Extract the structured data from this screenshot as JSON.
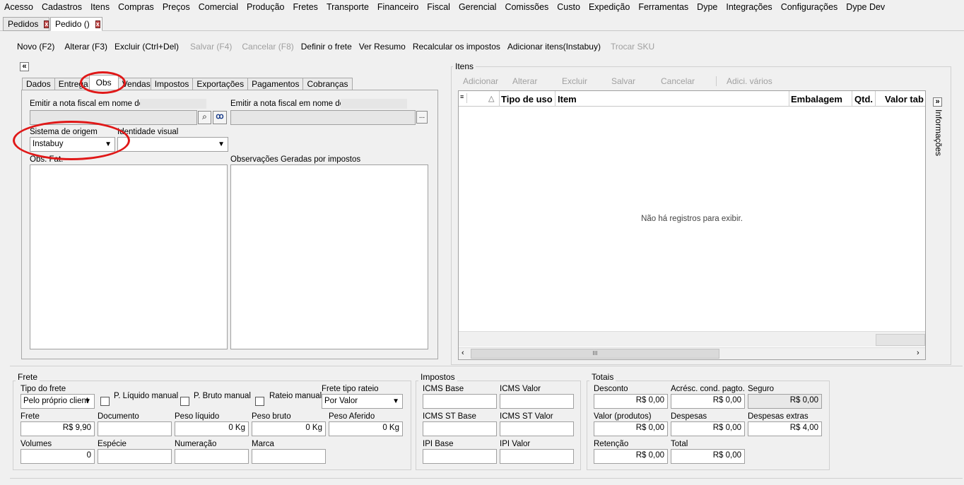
{
  "menu": [
    "Acesso",
    "Cadastros",
    "Itens",
    "Compras",
    "Preços",
    "Comercial",
    "Produção",
    "Fretes",
    "Transporte",
    "Financeiro",
    "Fiscal",
    "Gerencial",
    "Comissões",
    "Custo",
    "Expedição",
    "Ferramentas",
    "Dype",
    "Integrações",
    "Configurações",
    "Dype Dev"
  ],
  "doc_tabs": [
    {
      "label": "Pedidos",
      "close": "x"
    },
    {
      "label": "Pedido ()",
      "close": "x"
    }
  ],
  "toolbar": {
    "novo": "Novo (F2)",
    "alterar": "Alterar (F3)",
    "excluir": "Excluir (Ctrl+Del)",
    "salvar": "Salvar (F4)",
    "cancelar": "Cancelar (F8)",
    "definir_frete": "Definir o frete",
    "ver_resumo": "Ver Resumo",
    "recalcular": "Recalcular os impostos",
    "adicionar_itens": "Adicionar itens(Instabuy)",
    "trocar_sku": "Trocar SKU"
  },
  "collapse_icon": "«",
  "left_tabs": [
    "Dados",
    "Entrega",
    "Obs",
    "Vendas",
    "Impostos",
    "Exportações",
    "Pagamentos",
    "Cobranças"
  ],
  "obs": {
    "emitir1_label": "Emitir a nota fiscal em nome de:",
    "emitir2_label": "Emitir a nota fiscal em nome de:",
    "sistema_origem_label": "Sistema de origem",
    "sistema_origem_value": "Instabuy",
    "identidade_visual_label": "Identidade visual",
    "identidade_visual_value": "",
    "obs_label": "Obs. Fat.",
    "obs_geradas_label": "Observações Geradas por impostos",
    "browse_label": "..."
  },
  "itens": {
    "title": "Itens",
    "buttons": [
      "Adicionar",
      "Alterar",
      "Excluir",
      "Salvar",
      "Cancelar",
      "Adici. vários"
    ],
    "columns": [
      "Tipo de uso",
      "Item",
      "Embalagem",
      "Qtd.",
      "Valor tab"
    ],
    "sort_icon": "△",
    "empty": "Não há registros para exibir.",
    "side_label": "Informações",
    "side_icon": "»",
    "scroll_thumb_glyph": "III"
  },
  "frete": {
    "title": "Frete",
    "tipo_frete_label": "Tipo do frete",
    "tipo_frete_value": "Pelo próprio client",
    "p_liquido_manual": "P. Líquido manual",
    "p_bruto_manual": "P. Bruto manual",
    "rateio_manual": "Rateio manual",
    "frete_tipo_rateio_label": "Frete tipo rateio",
    "frete_tipo_rateio_value": "Por Valor",
    "frete_label": "Frete",
    "frete_value": "R$ 9,90",
    "documento_label": "Documento",
    "documento_value": "",
    "peso_liquido_label": "Peso líquido",
    "peso_liquido_value": "0 Kg",
    "peso_bruto_label": "Peso bruto",
    "peso_bruto_value": "0 Kg",
    "peso_aferido_label": "Peso Aferido",
    "peso_aferido_value": "0 Kg",
    "volumes_label": "Volumes",
    "volumes_value": "0",
    "especie_label": "Espécie",
    "numeracao_label": "Numeração",
    "marca_label": "Marca"
  },
  "impostos": {
    "title": "Impostos",
    "icms_base": "ICMS Base",
    "icms_valor": "ICMS Valor",
    "icms_st_base": "ICMS ST Base",
    "icms_st_valor": "ICMS ST Valor",
    "ipi_base": "IPI Base",
    "ipi_valor": "IPI Valor"
  },
  "totais": {
    "title": "Totais",
    "desconto_label": "Desconto",
    "desconto_value": "R$ 0,00",
    "acresc_label": "Acrésc. cond. pagto.",
    "acresc_value": "R$ 0,00",
    "seguro_label": "Seguro",
    "seguro_value": "R$ 0,00",
    "valor_produtos_label": "Valor (produtos)",
    "valor_produtos_value": "R$ 0,00",
    "despesas_label": "Despesas",
    "despesas_value": "R$ 0,00",
    "despesas_extras_label": "Despesas extras",
    "despesas_extras_value": "R$ 4,00",
    "retencao_label": "Retenção",
    "retencao_value": "R$ 0,00",
    "total_label": "Total",
    "total_value": "R$ 0,00"
  },
  "colors": {
    "annotation": "#e01818",
    "window_bg": "#f0f0f0"
  }
}
